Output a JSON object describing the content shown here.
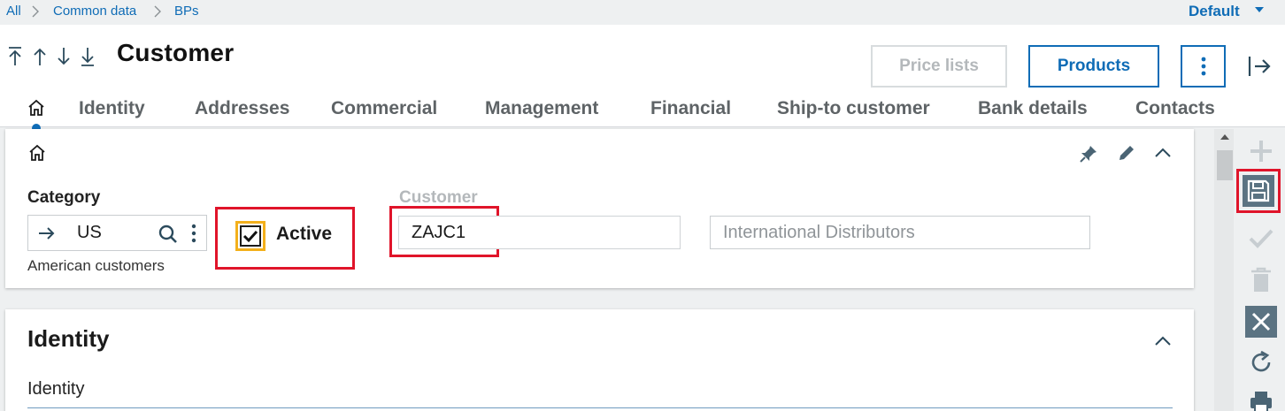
{
  "breadcrumb": {
    "items": [
      "All",
      "Common data",
      "BPs"
    ]
  },
  "profile": {
    "label": "Default"
  },
  "header": {
    "title": "Customer",
    "buttons": {
      "price_lists": "Price lists",
      "products": "Products"
    }
  },
  "tabs": [
    "Identity",
    "Addresses",
    "Commercial",
    "Management",
    "Financial",
    "Ship-to customer",
    "Bank details",
    "Contacts"
  ],
  "section_main": {
    "category": {
      "label": "Category",
      "value": "US",
      "description": "American customers"
    },
    "active": {
      "label": "Active",
      "checked": true
    },
    "customer": {
      "label": "Customer",
      "value": "ZAJC1",
      "name_value": "International Distributors"
    }
  },
  "section_identity": {
    "title": "Identity",
    "subtitle": "Identity"
  },
  "icons": {
    "nav": [
      "first-icon",
      "previous-icon",
      "next-icon",
      "last-icon"
    ],
    "toolbar": [
      "plus-icon",
      "save-icon",
      "check-icon",
      "trash-icon",
      "close-icon",
      "refresh-icon",
      "print-icon"
    ]
  },
  "colors": {
    "accent": "#0f6cb6",
    "highlight": "#e0142a",
    "checkbox_border": "#f3b01c",
    "toolbar_dark": "#5b7382"
  }
}
